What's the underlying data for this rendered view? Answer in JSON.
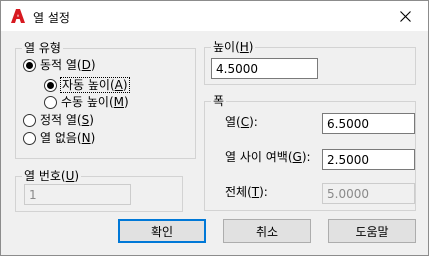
{
  "titlebar": {
    "title": "열 설정",
    "app_icon": "autocad-logo-icon",
    "close_icon": "close-icon"
  },
  "column_type": {
    "label": "열 유형",
    "options": [
      {
        "label": "동적 열(",
        "mnemonic": "D",
        "suffix": ")",
        "selected": true
      },
      {
        "label": "자동 높이(",
        "mnemonic": "A",
        "suffix": ")",
        "selected": true
      },
      {
        "label": "수동 높이(",
        "mnemonic": "M",
        "suffix": ")",
        "selected": false
      },
      {
        "label": "정적 열(",
        "mnemonic": "S",
        "suffix": ")",
        "selected": false
      },
      {
        "label": "열 없음(",
        "mnemonic": "N",
        "suffix": ")",
        "selected": false
      }
    ]
  },
  "column_number": {
    "label": "열 번호(",
    "mnemonic": "U",
    "suffix": ")",
    "value": "1"
  },
  "height": {
    "label": "높이(",
    "mnemonic": "H",
    "suffix": ")",
    "value": "4.5000"
  },
  "width": {
    "label": "폭",
    "column": {
      "label": "열(",
      "mnemonic": "C",
      "suffix": "):",
      "value": "6.5000"
    },
    "gutter": {
      "label": "열 사이 여백(",
      "mnemonic": "G",
      "suffix": "):",
      "value": "2.5000"
    },
    "total": {
      "label": "전체(",
      "mnemonic": "T",
      "suffix": "):",
      "value": "5.0000"
    }
  },
  "buttons": {
    "ok": "확인",
    "cancel": "취소",
    "help": "도움말"
  },
  "colors": {
    "accent": "#0078d7",
    "logo_red": "#d71920"
  }
}
